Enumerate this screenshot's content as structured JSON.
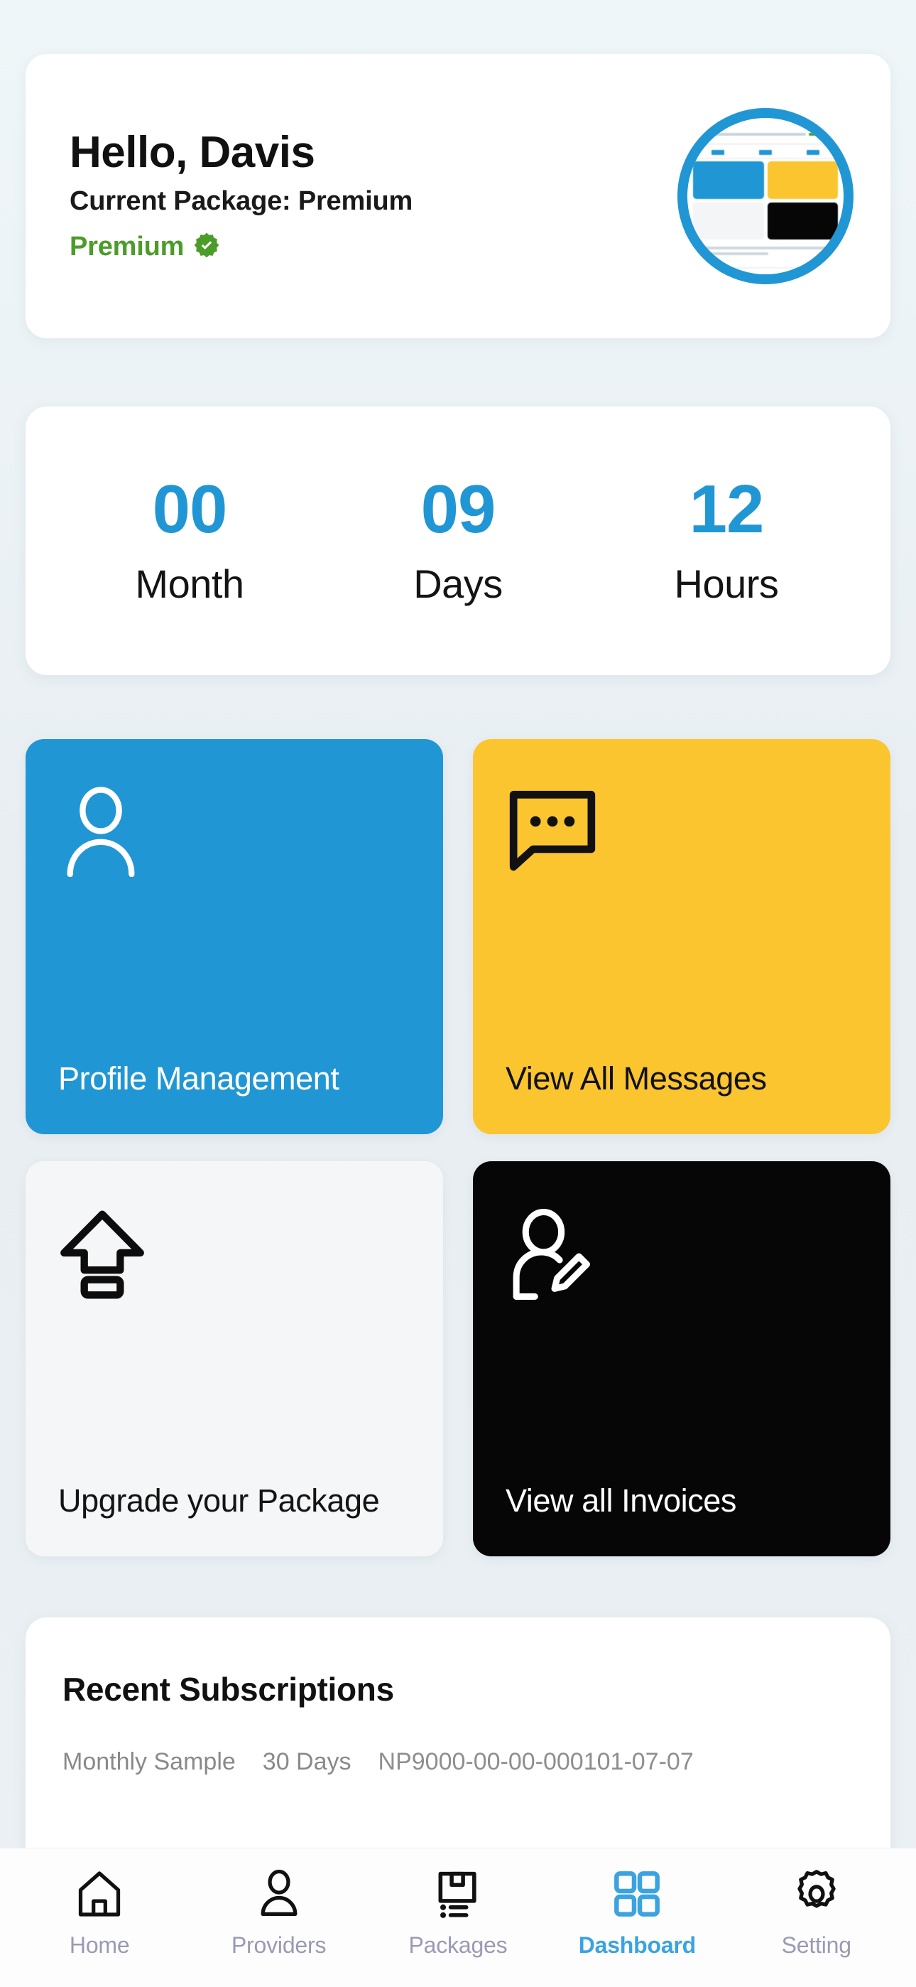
{
  "theme": {
    "accent_blue": "#2196d4",
    "nav_active_blue": "#3ba3e0",
    "accent_yellow": "#fbc530",
    "premium_green": "#4c9c2a",
    "dark_tile": "#060606",
    "light_tile": "#f5f6f7",
    "page_background": "#eaf0f3",
    "nav_inactive": "#9a9ab4"
  },
  "greeting": {
    "title": "Hello, Davis",
    "current_package": "Current Package: Premium",
    "status_badge": "Premium",
    "verified_icon": "verified-check-icon",
    "avatar_icon": "user-avatar-thumbnail"
  },
  "countdown": {
    "units": [
      {
        "value": "00",
        "label": "Month"
      },
      {
        "value": "09",
        "label": "Days"
      },
      {
        "value": "12",
        "label": "Hours"
      }
    ]
  },
  "tiles": [
    {
      "label": "Profile Management",
      "icon": "person-outline-icon"
    },
    {
      "label": "View All Messages",
      "icon": "chat-bubble-dots-icon"
    },
    {
      "label": "Upgrade your Package",
      "icon": "upload-arrow-icon"
    },
    {
      "label": "View all Invoices",
      "icon": "person-edit-icon"
    }
  ],
  "recent_subscriptions": {
    "title": "Recent Subscriptions",
    "rows": [
      {
        "plan": "Monthly Sample",
        "duration": "30 Days",
        "reference": "NP9000-00-00-000101-07-07"
      }
    ]
  },
  "bottom_nav": {
    "items": [
      {
        "label": "Home",
        "icon": "home-icon",
        "active": false
      },
      {
        "label": "Providers",
        "icon": "person-icon",
        "active": false
      },
      {
        "label": "Packages",
        "icon": "package-list-icon",
        "active": false
      },
      {
        "label": "Dashboard",
        "icon": "grid-four-squares-icon",
        "active": true
      },
      {
        "label": "Setting",
        "icon": "gear-icon",
        "active": false
      }
    ]
  }
}
